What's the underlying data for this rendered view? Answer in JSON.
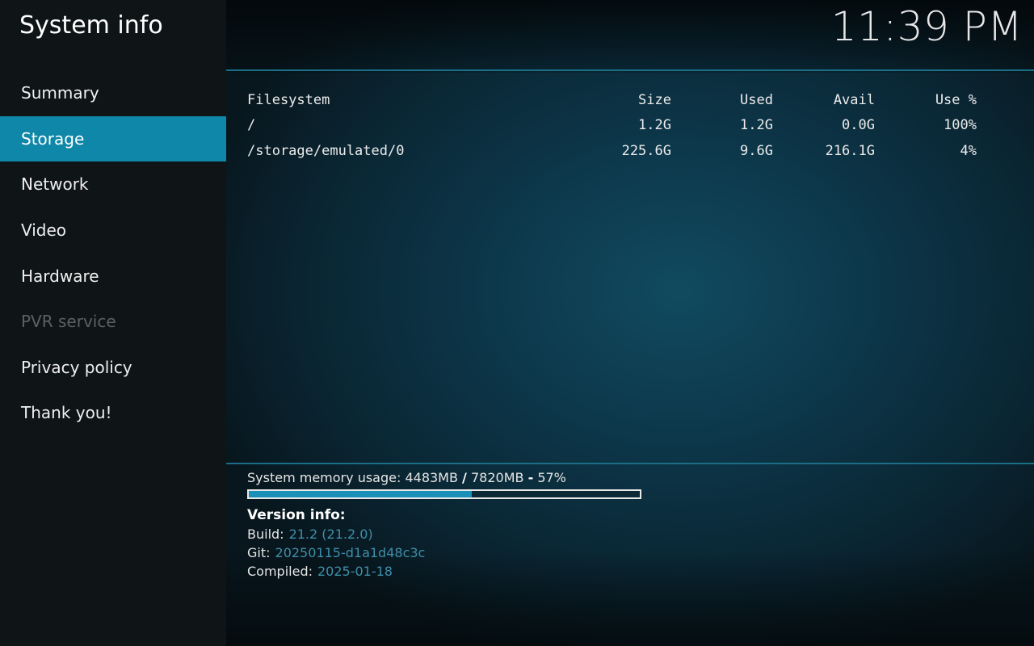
{
  "app_title": "System info",
  "clock": "11:39 PM",
  "sidebar": {
    "items": [
      {
        "label": "Summary",
        "state": "normal"
      },
      {
        "label": "Storage",
        "state": "active"
      },
      {
        "label": "Network",
        "state": "normal"
      },
      {
        "label": "Video",
        "state": "normal"
      },
      {
        "label": "Hardware",
        "state": "normal"
      },
      {
        "label": "PVR service",
        "state": "disabled"
      },
      {
        "label": "Privacy policy",
        "state": "normal"
      },
      {
        "label": "Thank you!",
        "state": "normal"
      }
    ]
  },
  "storage_table": {
    "headers": [
      "Filesystem",
      "Size",
      "Used",
      "Avail",
      "Use %"
    ],
    "rows": [
      [
        "/",
        "1.2G",
        "1.2G",
        "0.0G",
        "100%"
      ],
      [
        "/storage/emulated/0",
        "225.6G",
        "9.6G",
        "216.1G",
        "4%"
      ]
    ]
  },
  "memory": {
    "prefix": "System memory usage: ",
    "used": "4483MB",
    "separator": "/",
    "total": "7820MB",
    "dash": "-",
    "percent_text": "57%",
    "usage_fraction": 0.57
  },
  "version": {
    "title": "Version info:",
    "build_label": "Build:",
    "build_value": "21.2 (21.2.0)",
    "git_label": "Git:",
    "git_value": "20250115-d1a1d48c3c",
    "compiled_label": "Compiled:",
    "compiled_value": "2025-01-18"
  },
  "colors": {
    "accent": "#0f87a8",
    "value_text": "#3f8fab",
    "progress_fill": "#1a8fb8"
  }
}
